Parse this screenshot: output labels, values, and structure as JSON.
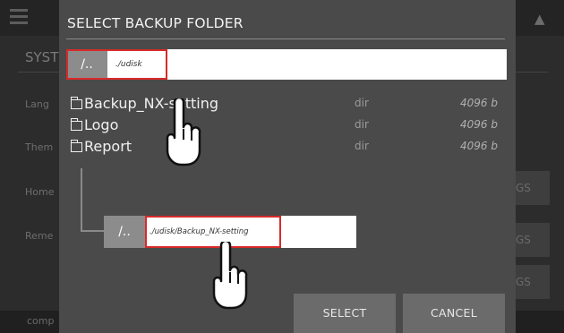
{
  "dialog": {
    "title": "SELECT BACKUP FOLDER",
    "path_bar": {
      "up_label": "/..",
      "path": "./udisk"
    },
    "files": [
      {
        "name": "Backup_NX-setting",
        "type": "dir",
        "size": "4096 b"
      },
      {
        "name": "Logo",
        "type": "dir",
        "size": "4096 b"
      },
      {
        "name": "Report",
        "type": "dir",
        "size": "4096 b"
      }
    ],
    "result_path_bar": {
      "up_label": "/..",
      "path": "./udisk/Backup_NX-setting"
    },
    "buttons": {
      "select_label": "SELECT",
      "cancel_label": "CANCEL"
    }
  },
  "background": {
    "title": "SYST",
    "labels": [
      "Lang",
      "Them",
      "Home",
      "Reme"
    ],
    "side_buttons": [
      "GS",
      "GS",
      "GS"
    ],
    "footer_text": "comp"
  },
  "icons": {
    "menu": "menu-icon",
    "home": "home-icon",
    "folder": "folder-icon",
    "pointer": "hand-pointer-icon"
  },
  "colors": {
    "highlight": "#d82a2a",
    "dialog_bg": "#4a4a4a",
    "button_bg": "#6b6b6b"
  }
}
